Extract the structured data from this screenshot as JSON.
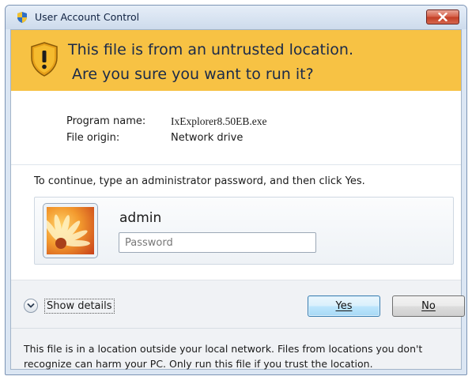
{
  "window": {
    "title": "User Account Control",
    "title_icon": "uac-shield-icon",
    "close_icon": "close-icon",
    "accent_close": "#c8432b"
  },
  "banner": {
    "line1": "This file is from an untrusted location.",
    "line2": "Are you sure you want to run it?",
    "icon": "warning-shield-icon",
    "color": "#f7c244"
  },
  "info": {
    "program_label": "Program name:",
    "program_value": "IxExplorer8.50EB.exe",
    "origin_label": "File origin:",
    "origin_value": "Network drive"
  },
  "credentials": {
    "instruction": "To continue, type an administrator password, and then click Yes.",
    "username": "admin",
    "password_placeholder": "Password",
    "password_value": ""
  },
  "footer": {
    "details_label": "Show details",
    "yes_label": "Yes",
    "no_label": "No",
    "note": "This file is in a location outside your local network. Files from locations you don't recognize can harm your PC. Only run this file if you trust the location."
  }
}
